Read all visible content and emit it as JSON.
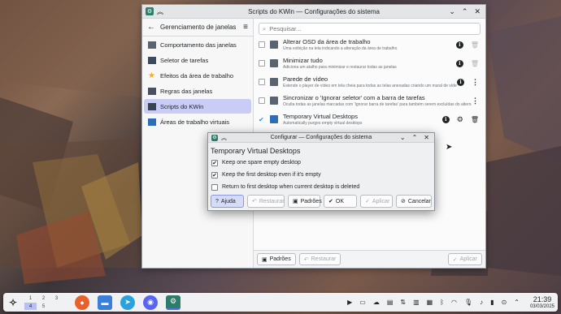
{
  "window": {
    "title": "Scripts do KWin — Configurações do sistema"
  },
  "sidebar": {
    "title": "Gerenciamento de janelas",
    "items": [
      {
        "label": "Comportamento das janelas",
        "icon": "window-behavior-icon"
      },
      {
        "label": "Seletor de tarefas",
        "icon": "task-switcher-icon"
      },
      {
        "label": "Efeitos da área de trabalho",
        "icon": "desktop-effects-icon"
      },
      {
        "label": "Regras das janelas",
        "icon": "window-rules-icon"
      },
      {
        "label": "Scripts do KWin",
        "icon": "kwin-scripts-icon"
      },
      {
        "label": "Áreas de trabalho virtuais",
        "icon": "virtual-desktops-icon"
      }
    ]
  },
  "search": {
    "placeholder": "Pesquisar..."
  },
  "scripts": [
    {
      "name": "Alterar OSD da área de trabalho",
      "desc": "Uma exibição na tela indicando a alteração da área de trabalho",
      "enabled": false
    },
    {
      "name": "Minimizar tudo",
      "desc": "Adiciona um atalho para minimizar e restaurar todas as janelas",
      "enabled": false
    },
    {
      "name": "Parede de vídeo",
      "desc": "Estende o player de vídeo em tela cheia para todas as telas anexadas criando um mural de vídeo",
      "enabled": false
    },
    {
      "name": "Sincronizar o 'Ignorar seletor' com a barra de tarefas",
      "desc": "Oculta todas as janelas marcadas com 'Ignorar barra de tarefas' para também serem excluídas do alternad...",
      "enabled": false
    },
    {
      "name": "Temporary Virtual Desktops",
      "desc": "Automatically purges empty virtual desktops",
      "enabled": true
    }
  ],
  "footer": {
    "defaults": "Padrões",
    "reset": "Restaurar",
    "apply": "Aplicar"
  },
  "dialog": {
    "title": "Configurar — Configurações do sistema",
    "heading": "Temporary Virtual Desktops",
    "options": [
      {
        "label": "Keep one spare empty desktop",
        "checked": true
      },
      {
        "label": "Keep the first desktop even if it's empty",
        "checked": true
      },
      {
        "label": "Return to first desktop when current desktop is deleted",
        "checked": false
      }
    ],
    "buttons": {
      "help": "Ajuda",
      "reset": "Restaurar",
      "defaults": "Padrões",
      "ok": "OK",
      "apply": "Aplicar",
      "cancel": "Cancelar"
    }
  },
  "taskbar": {
    "pager": [
      "1",
      "2",
      "3",
      "4",
      "5"
    ],
    "apps": [
      "firefox-icon",
      "files-icon",
      "telegram-icon",
      "discord-icon",
      "system-settings-icon"
    ],
    "time": "21:39",
    "date": "03/03/2025"
  },
  "colors": {
    "accent": "#c9cdf5",
    "selection": "#1d99f3"
  }
}
